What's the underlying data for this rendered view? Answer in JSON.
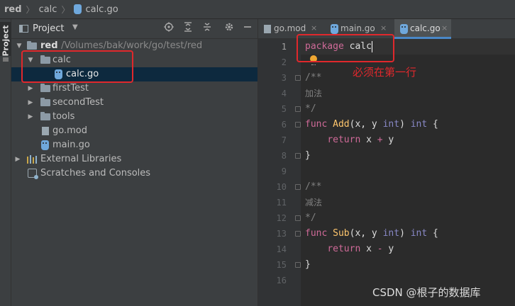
{
  "breadcrumb": {
    "items": [
      "red",
      "calc",
      "calc.go"
    ],
    "separator": "〉"
  },
  "tool_strip": {
    "label": "Project"
  },
  "project_panel": {
    "title": "Project",
    "dropdown_icon": "caret-down-icon",
    "toolbar_icons": [
      "crosshair-icon",
      "expand-all-icon",
      "collapse-all-icon",
      "gear-icon",
      "minimize-icon"
    ],
    "tree": [
      {
        "name": "red",
        "path": "/Volumes/bak/work/go/test/red",
        "type": "folder",
        "expanded": true,
        "level": 0
      },
      {
        "name": "calc",
        "type": "folder",
        "expanded": true,
        "level": 1
      },
      {
        "name": "calc.go",
        "type": "go-file",
        "level": 2,
        "selected": true
      },
      {
        "name": "firstTest",
        "type": "folder",
        "expanded": false,
        "level": 1
      },
      {
        "name": "secondTest",
        "type": "folder",
        "expanded": false,
        "level": 1
      },
      {
        "name": "tools",
        "type": "folder",
        "expanded": false,
        "level": 1
      },
      {
        "name": "go.mod",
        "type": "mod-file",
        "level": 1
      },
      {
        "name": "main.go",
        "type": "go-file",
        "level": 1
      },
      {
        "name": "External Libraries",
        "type": "libraries",
        "expanded": false,
        "level": 0
      },
      {
        "name": "Scratches and Consoles",
        "type": "scratches",
        "level": 0
      }
    ]
  },
  "editor": {
    "tabs": [
      {
        "label": "go.mod",
        "active": false
      },
      {
        "label": "main.go",
        "active": false
      },
      {
        "label": "calc.go",
        "active": true
      }
    ],
    "close_glyph": "×",
    "current_line": 1,
    "line_numbers": [
      "1",
      "2",
      "3",
      "4",
      "5",
      "6",
      "7",
      "8",
      "9",
      "10",
      "11",
      "12",
      "13",
      "14",
      "15",
      "16"
    ],
    "code": {
      "l1_kw": "package",
      "l1_name": "calc",
      "l3": "/**",
      "l4": "加法",
      "l5": "*/",
      "l6_kw": "func",
      "l6_fn": "Add",
      "l6_a": "(x, y ",
      "l6_t1": "int",
      "l6_b": ") ",
      "l6_t2": "int",
      "l6_c": " {",
      "l7_kw": "return",
      "l7_a": " x ",
      "l7_op": "+",
      "l7_b": " y",
      "l8": "}",
      "l10": "/**",
      "l11": "减法",
      "l12": "*/",
      "l13_kw": "func",
      "l13_fn": "Sub",
      "l13_a": "(x, y ",
      "l13_t1": "int",
      "l13_b": ") ",
      "l13_t2": "int",
      "l13_c": " {",
      "l14_kw": "return",
      "l14_a": " x ",
      "l14_op": "-",
      "l14_b": " y",
      "l15": "}"
    }
  },
  "annotation": {
    "text": "必须在第一行",
    "color": "#e0282c"
  },
  "watermark": "CSDN @根子的数据库",
  "colors": {
    "keyword": "#cc7832",
    "function": "#ffc66d",
    "type": "#8888c6",
    "comment": "#808080",
    "selection": "#0d293e",
    "accent": "#4a88c7"
  }
}
